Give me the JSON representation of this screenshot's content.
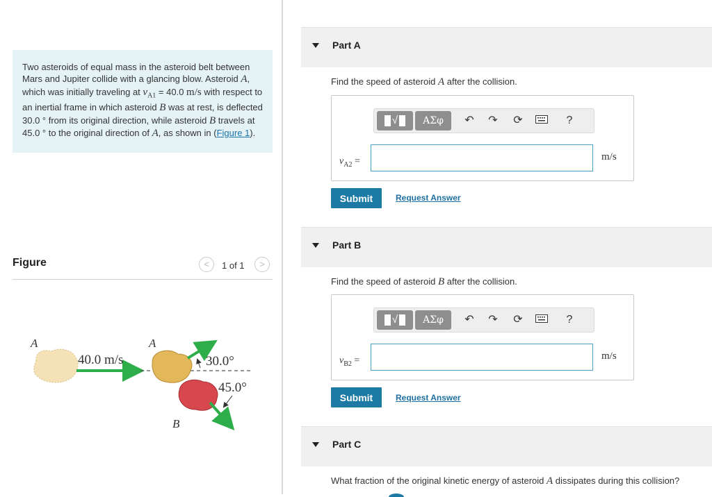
{
  "problem": {
    "t1": "Two asteroids of equal mass in the asteroid belt between Mars and Jupiter collide with a glancing blow. Asteroid ",
    "A": "A",
    "t2": ", which was initially traveling at ",
    "vA1": "v",
    "vA1_sub": "A1",
    "t3": " = 40.0 ",
    "unit": "m/s",
    "t4": " with respect to an inertial frame in which asteroid ",
    "B": "B",
    "t5": " was at rest, is deflected 30.0 ° from its original direction, while asteroid ",
    "t6": " travels at 45.0 ° to the original direction of ",
    "t7": ", as shown in (",
    "figure_link": "Figure 1",
    "t8": ")."
  },
  "figure": {
    "title": "Figure",
    "prev": "<",
    "next": ">",
    "count": "1 of 1",
    "labels": {
      "A_left": "A",
      "speed": "40.0 m/s",
      "A_right": "A",
      "angle1": "30.0°",
      "angle2": "45.0°",
      "B": "B"
    },
    "colors": {
      "arrow": "#2eae4a",
      "asteroid_a": "#e3b85a",
      "asteroid_b": "#d9474e",
      "ghost": "#f4e1b6"
    }
  },
  "parts": [
    {
      "title": "Part A",
      "question_pre": "Find the speed of asteroid ",
      "question_var": "A",
      "question_post": " after the collision.",
      "var": "v",
      "var_sub": "A2",
      "eq": " =",
      "unit": "m/s",
      "value": "",
      "submit": "Submit",
      "request": "Request Answer"
    },
    {
      "title": "Part B",
      "question_pre": "Find the speed of asteroid ",
      "question_var": "B",
      "question_post": " after the collision.",
      "var": "v",
      "var_sub": "B2",
      "eq": " =",
      "unit": "m/s",
      "value": "",
      "submit": "Submit",
      "request": "Request Answer"
    },
    {
      "title": "Part C",
      "question_pre": "What fraction of the original kinetic energy of asteroid ",
      "question_var": "A",
      "question_post": " dissipates during this collision?"
    }
  ],
  "toolbar": {
    "template": "√",
    "symbols": "ΑΣφ",
    "undo": "↶",
    "redo": "↷",
    "reset": "⟳",
    "keyboard": "keyboard",
    "help": "?"
  }
}
